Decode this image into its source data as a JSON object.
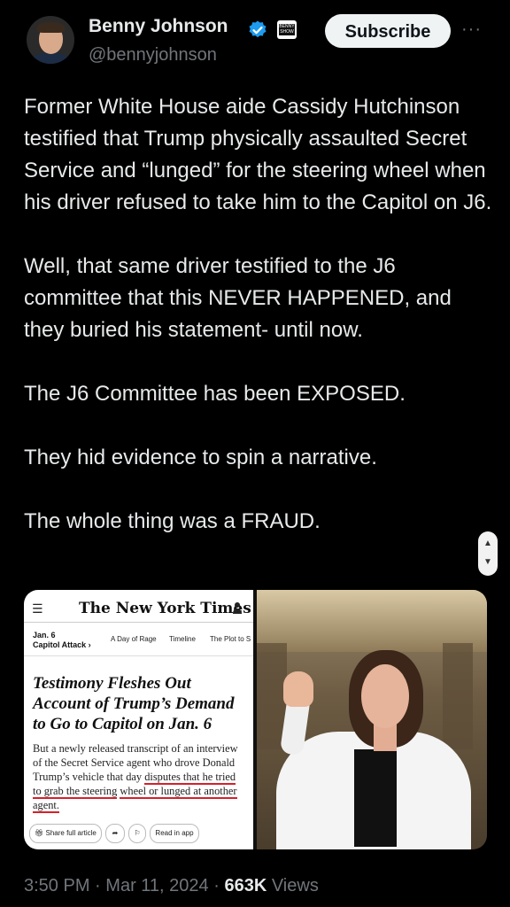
{
  "author": {
    "name": "Benny Johnson",
    "handle": "@bennyjohnson",
    "verified_color": "#1d9bf0"
  },
  "actions": {
    "subscribe_label": "Subscribe",
    "more_label": "···"
  },
  "post": {
    "paragraphs": [
      "Former White House aide Cassidy Hutchinson testified that Trump physically assaulted Secret Service and “lunged” for the steering wheel when his driver refused to take him to the Capitol on J6.",
      "Well, that same driver testified to the J6 committee that this NEVER HAPPENED, and they buried his statement- until now.",
      "The J6 Committee has been EXPOSED.",
      "They hid evidence to spin a narrative.",
      "The whole thing was a FRAUD."
    ]
  },
  "media": {
    "nyt": {
      "logo": "The New York Times",
      "section_line1": "Jan. 6",
      "section_line2": "Capitol Attack ›",
      "nav": [
        "A Day of Rage",
        "Timeline",
        "The Plot to S"
      ],
      "headline": "Testimony Fleshes Out Account of Trump’s Demand to Go to Capitol on Jan. 6",
      "summary_plain": "But a newly released transcript of an interview of the Secret Service agent who drove Donald Trump’s vehicle that day ",
      "summary_underlined_1": "disputes that he tried to grab the steering",
      "summary_underlined_2": "wheel or lunged at another agent.",
      "share_label": "Share full article",
      "read_label": "Read in app"
    },
    "accent_underline_color": "#d6202a"
  },
  "footer": {
    "time": "3:50 PM",
    "date": "Mar 11, 2024",
    "views_count": "663K",
    "views_label": "Views",
    "separator": "·"
  }
}
